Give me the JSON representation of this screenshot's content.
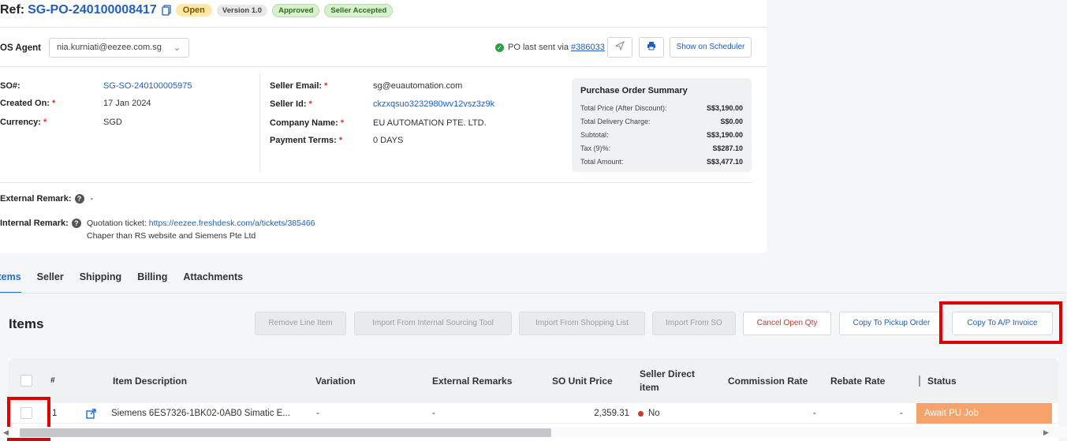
{
  "header": {
    "ref_label": "Ref:",
    "ref_value": "SG-PO-240100008417",
    "badges": {
      "open": "Open",
      "version": "Version 1.0",
      "approved": "Approved",
      "seller_accepted": "Seller Accepted"
    }
  },
  "agent": {
    "label": "OS Agent",
    "value": "nia.kurniati@eezee.com.sg"
  },
  "po_sent": {
    "text": "PO last sent via",
    "link": "#386033"
  },
  "buttons": {
    "show_scheduler": "Show on Scheduler"
  },
  "fields_left": [
    {
      "label": "SO#:",
      "value": "SG-SO-240100005975"
    },
    {
      "label": "Created On:",
      "value": "17 Jan 2024"
    },
    {
      "label": "Currency:",
      "value": "SGD"
    }
  ],
  "fields_mid": [
    {
      "label": "Seller Email:",
      "value": "sg@euautomation.com"
    },
    {
      "label": "Seller Id:",
      "value": "ckzxqsuo3232980wv12vsz3z9k"
    },
    {
      "label": "Company Name:",
      "value": "EU AUTOMATION PTE. LTD."
    },
    {
      "label": "Payment Terms:",
      "value": "0 DAYS"
    }
  ],
  "summary": {
    "title": "Purchase Order Summary",
    "rows": [
      {
        "label": "Total Price (After Discount):",
        "value": "S$3,190.00"
      },
      {
        "label": "Total Delivery Charge:",
        "value": "S$0.00"
      },
      {
        "label": "Subtotal:",
        "value": "S$3,190.00"
      },
      {
        "label": "Tax (9)%:",
        "value": "S$287.10"
      },
      {
        "label": "Total Amount:",
        "value": "S$3,477.10"
      }
    ]
  },
  "remarks": {
    "external_label": "External Remark:",
    "external_value": "-",
    "internal_label": "Internal Remark:",
    "internal_prefix": "Quotation ticket:",
    "internal_link": "https://eezee.freshdesk.com/a/tickets/385466",
    "internal_line2": "Chaper than RS website and Siemens Pte Ltd"
  },
  "tabs": [
    "Items",
    "Seller",
    "Shipping",
    "Billing",
    "Attachments"
  ],
  "items": {
    "title": "Items",
    "actions": {
      "remove": "Remove Line Item",
      "import_internal": "Import From Internal Sourcing Tool",
      "import_shopping": "Import From Shopping List",
      "import_so": "Import From SO",
      "cancel_qty": "Cancel Open Qty",
      "copy_pickup": "Copy To Pickup Order",
      "copy_ap": "Copy To A/P Invoice"
    },
    "columns": {
      "num": "#",
      "desc": "Item Description",
      "variation": "Variation",
      "ext_remarks": "External Remarks",
      "so_price": "SO Unit Price",
      "seller_direct_1": "Seller Direct",
      "seller_direct_2": "item",
      "commission": "Commission Rate",
      "rebate": "Rebate Rate",
      "status": "Status"
    },
    "row": {
      "num": "1",
      "desc": "Siemens 6ES7326-1BK02-0AB0 Simatic E...",
      "variation": "-",
      "ext_remarks": "-",
      "so_price": "2,359.31",
      "seller_direct": "No",
      "commission": "-",
      "rebate": "-",
      "status": "Await PU Job"
    }
  },
  "colors": {
    "accent": "#1f5fbf",
    "status": "#f5a36a",
    "highlight": "#e00000"
  }
}
